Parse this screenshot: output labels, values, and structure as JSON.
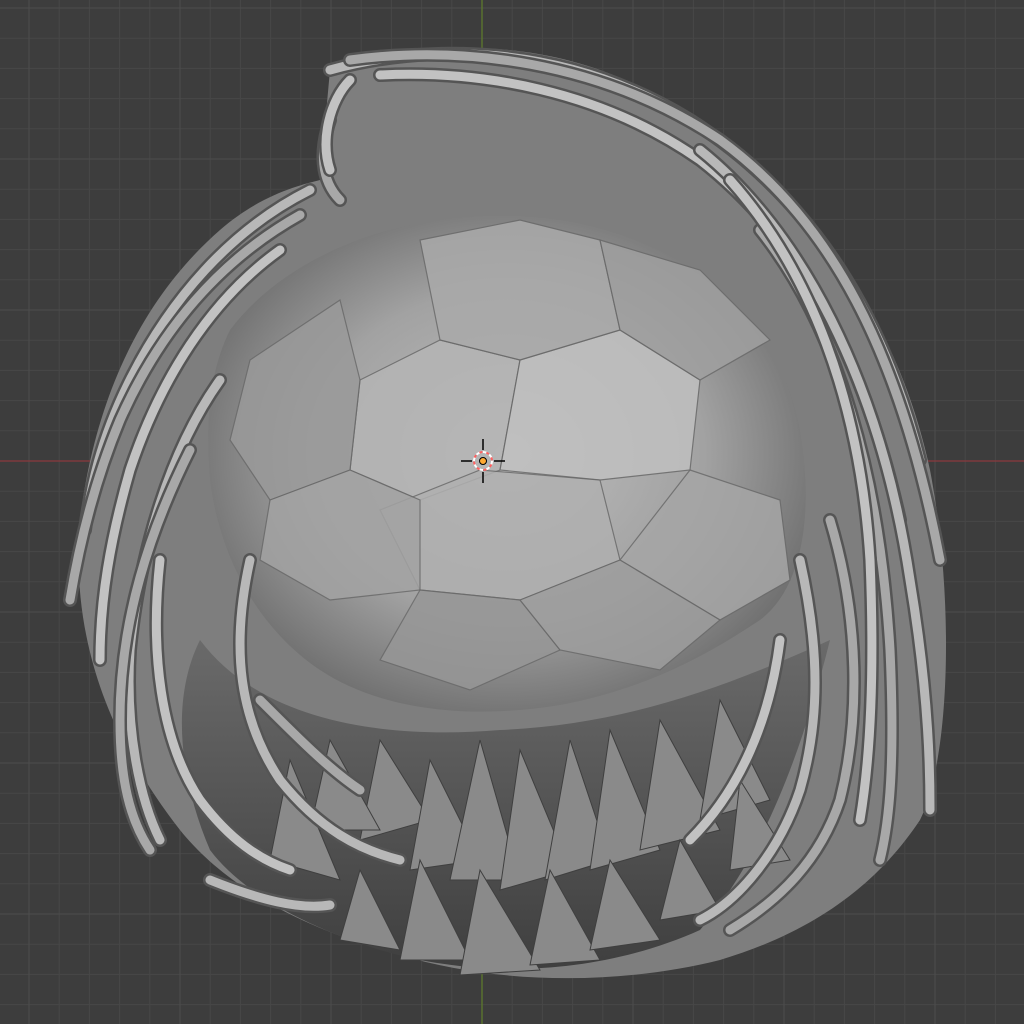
{
  "viewport": {
    "background": "#3d3d3d",
    "grid_minor_color": "#474747",
    "grid_major_color": "#4d4d4d",
    "axis_x_color": "#8b3a3e",
    "axis_y_color": "#5d7a2c"
  },
  "model": {
    "base_color": "#8f8f8f",
    "shade_color": "#4a4a4a",
    "light_color": "#c4c4c4"
  },
  "cursor_3d": {
    "ring_color": "#ffffff",
    "accent_color": "#ff6060",
    "origin_color": "#ffaa33"
  }
}
